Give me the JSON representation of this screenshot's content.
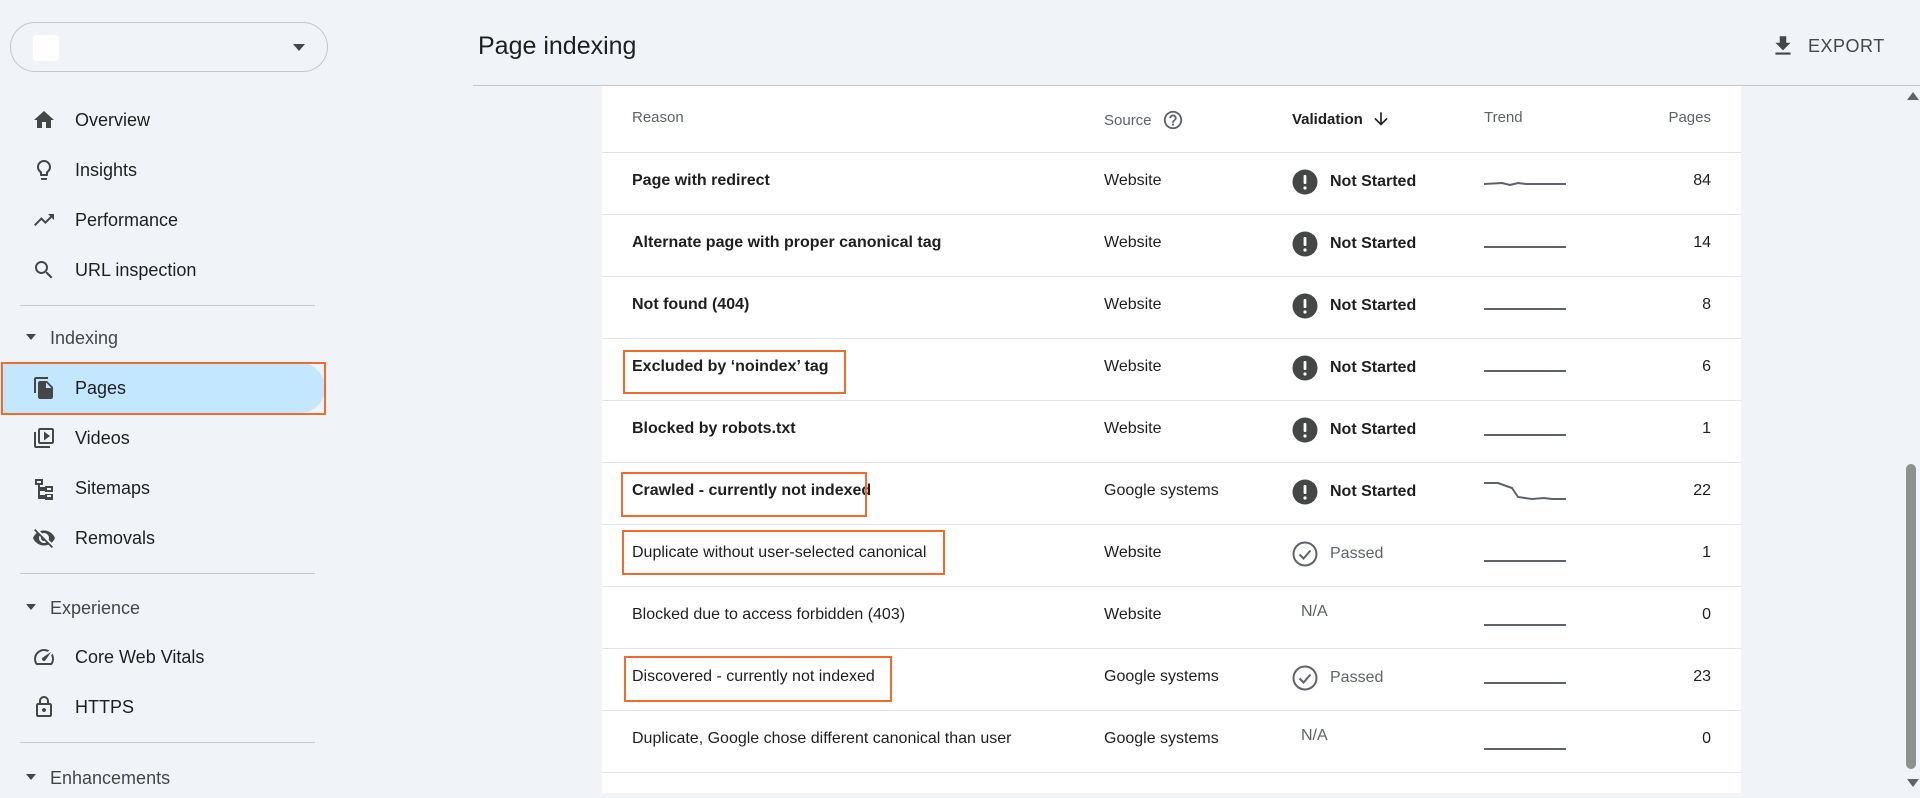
{
  "sidebar": {
    "property_name": "",
    "overview": "Overview",
    "insights": "Insights",
    "performance": "Performance",
    "url_inspection": "URL inspection",
    "indexing_header": "Indexing",
    "pages": "Pages",
    "videos": "Videos",
    "sitemaps": "Sitemaps",
    "removals": "Removals",
    "experience_header": "Experience",
    "core_web_vitals": "Core Web Vitals",
    "https": "HTTPS",
    "enhancements_header": "Enhancements"
  },
  "header": {
    "title": "Page indexing",
    "export_label": "EXPORT"
  },
  "table": {
    "columns": {
      "reason": "Reason",
      "source": "Source",
      "validation": "Validation",
      "trend": "Trend",
      "pages": "Pages"
    },
    "rows": [
      {
        "reason": "Page with redirect",
        "source": "Website",
        "validation": "Not Started",
        "pages": "84"
      },
      {
        "reason": "Alternate page with proper canonical tag",
        "source": "Website",
        "validation": "Not Started",
        "pages": "14"
      },
      {
        "reason": "Not found (404)",
        "source": "Website",
        "validation": "Not Started",
        "pages": "8"
      },
      {
        "reason": "Excluded by ‘noindex’ tag",
        "source": "Website",
        "validation": "Not Started",
        "pages": "6"
      },
      {
        "reason": "Blocked by robots.txt",
        "source": "Website",
        "validation": "Not Started",
        "pages": "1"
      },
      {
        "reason": "Crawled - currently not indexed",
        "source": "Google systems",
        "validation": "Not Started",
        "pages": "22"
      },
      {
        "reason": "Duplicate without user-selected canonical",
        "source": "Website",
        "validation": "Passed",
        "pages": "1"
      },
      {
        "reason": "Blocked due to access forbidden (403)",
        "source": "Website",
        "validation": "N/A",
        "pages": "0"
      },
      {
        "reason": "Discovered - currently not indexed",
        "source": "Google systems",
        "validation": "Passed",
        "pages": "23"
      },
      {
        "reason": "Duplicate, Google chose different canonical than user",
        "source": "Google systems",
        "validation": "N/A",
        "pages": "0"
      }
    ]
  },
  "colors": {
    "accent_highlight": "#ee6d2e",
    "active_nav_bg": "#c2e7ff",
    "status_icon": "#444746"
  }
}
